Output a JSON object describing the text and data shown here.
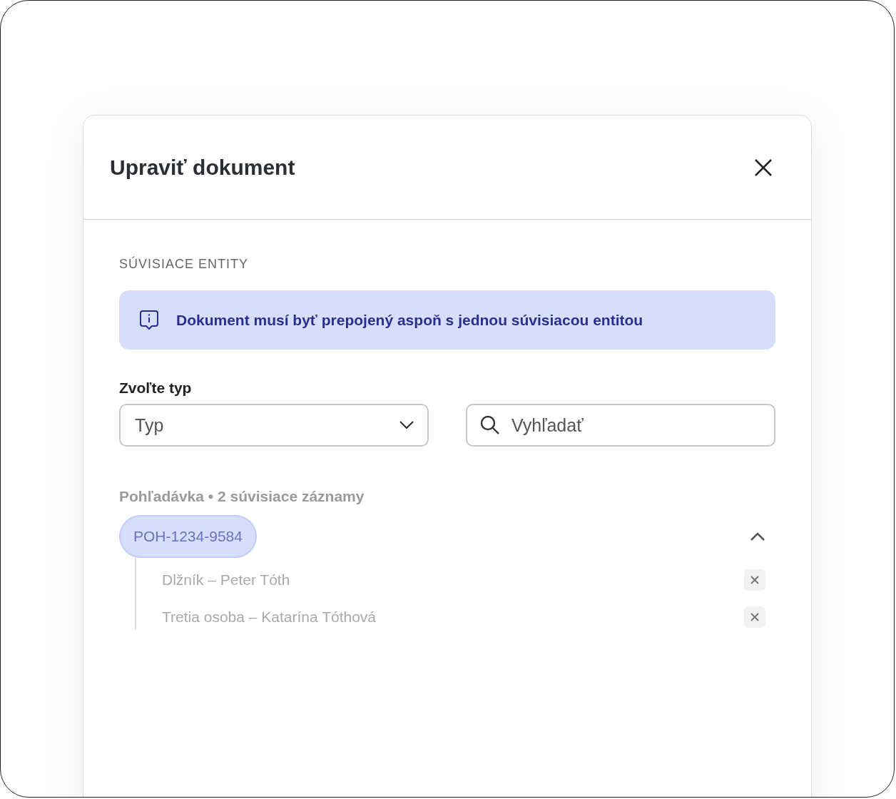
{
  "dialog": {
    "title": "Upraviť dokument"
  },
  "section": {
    "heading": "SÚVISIACE ENTITY"
  },
  "notice": {
    "text": "Dokument musí byť prepojený aspoň s jednou súvisiacou entitou"
  },
  "type_select": {
    "label": "Zvoľte typ",
    "placeholder": "Typ"
  },
  "search": {
    "placeholder": "Vyhľadať"
  },
  "groups": [
    {
      "heading": "Pohľadávka • 2 súvisiace záznamy",
      "chip": "POH-1234-9584",
      "expanded": true,
      "children": [
        {
          "label": "Dlžník – Peter Tóth"
        },
        {
          "label": "Tretia osoba – Katarína Tóthová"
        }
      ]
    }
  ]
}
